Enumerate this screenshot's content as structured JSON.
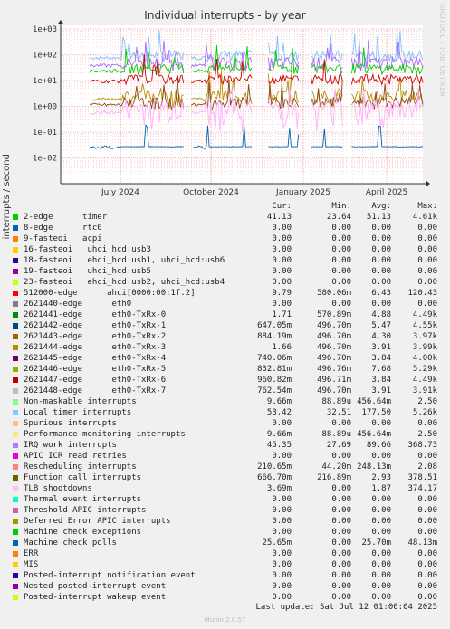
{
  "graph": {
    "title": "Individual interrupts - by year",
    "ylabel": "interrupts / second",
    "watermark": "RRDTOOL / TOBI OETIKER",
    "footer": "Munin 2.0.57",
    "last_update": "Last update: Sat Jul 12 01:00:04 2025"
  },
  "columns": {
    "cur": "Cur:",
    "min": "Min:",
    "avg": "Avg:",
    "max": "Max:"
  },
  "chart_data": {
    "type": "line",
    "title": "Individual interrupts - by year",
    "ylabel": "interrupts / second",
    "yscale": "log",
    "ylim": [
      0.001,
      1000
    ],
    "y_ticks": [
      {
        "v": 0.01,
        "label": "1e-02"
      },
      {
        "v": 0.1,
        "label": "1e-01"
      },
      {
        "v": 1,
        "label": "1e+00"
      },
      {
        "v": 10,
        "label": "1e+01"
      },
      {
        "v": 100,
        "label": "1e+02"
      },
      {
        "v": 1000,
        "label": "1e+03"
      }
    ],
    "x_ticks": [
      {
        "t": 0.165,
        "label": "July 2024"
      },
      {
        "t": 0.415,
        "label": "October 2024"
      },
      {
        "t": 0.67,
        "label": "January 2025"
      },
      {
        "t": 0.9,
        "label": "April 2025"
      }
    ],
    "grid": true,
    "approx_series": [
      {
        "name": "Local timer interrupts",
        "color": "#7ec2ff",
        "base": 80,
        "wide": 0.6
      },
      {
        "name": "Function call interrupts",
        "color": "#b78e00",
        "base": 2,
        "wide": 0.9
      },
      {
        "name": "IRQ work interrupts",
        "color": "#a06cff",
        "base": 40,
        "wide": 0.7
      },
      {
        "name": "2-edge",
        "color": "#00cc00",
        "base": 25,
        "wide": 0.5
      },
      {
        "name": "Rescheduling interrupts",
        "color": "#cc0000",
        "base": 10,
        "wide": 0.5
      },
      {
        "name": "2621441-edge",
        "color": "#8b4513",
        "base": 1.2,
        "wide": 0.6
      },
      {
        "name": "TLB shootdowns",
        "color": "#ffb0ff",
        "base": 0.6,
        "wide": 1.4
      },
      {
        "name": "Machine check polls",
        "color": "#0066b3",
        "base": 0.027,
        "wide": 0.02
      }
    ]
  },
  "legend": [
    {
      "label": "2-edge      timer",
      "color": "#00cc00",
      "cur": "41.13",
      "min": "23.64",
      "avg": "51.13",
      "max": "4.61k"
    },
    {
      "label": "8-edge      rtc0",
      "color": "#0066b3",
      "cur": "0.00",
      "min": "0.00",
      "avg": "0.00",
      "max": "0.00"
    },
    {
      "label": "9-fasteoi   acpi",
      "color": "#ff8000",
      "cur": "0.00",
      "min": "0.00",
      "avg": "0.00",
      "max": "0.00"
    },
    {
      "label": "16-fasteoi   uhci_hcd:usb3",
      "color": "#ffcc00",
      "cur": "0.00",
      "min": "0.00",
      "avg": "0.00",
      "max": "0.00"
    },
    {
      "label": "18-fasteoi   ehci_hcd:usb1, uhci_hcd:usb6",
      "color": "#330099",
      "cur": "0.00",
      "min": "0.00",
      "avg": "0.00",
      "max": "0.00"
    },
    {
      "label": "19-fasteoi   uhci_hcd:usb5",
      "color": "#990099",
      "cur": "0.00",
      "min": "0.00",
      "avg": "0.00",
      "max": "0.00"
    },
    {
      "label": "23-fasteoi   ehci_hcd:usb2, uhci_hcd:usb4",
      "color": "#ccff00",
      "cur": "0.00",
      "min": "0.00",
      "avg": "0.00",
      "max": "0.00"
    },
    {
      "label": "512000-edge      ahci[0000:00:1f.2]",
      "color": "#ff0000",
      "cur": "9.79",
      "min": "580.06m",
      "avg": "6.43",
      "max": "120.43"
    },
    {
      "label": "2621440-edge      eth0",
      "color": "#808080",
      "cur": "0.00",
      "min": "0.00",
      "avg": "0.00",
      "max": "0.00"
    },
    {
      "label": "2621441-edge      eth0-TxRx-0",
      "color": "#008f00",
      "cur": "1.71",
      "min": "570.89m",
      "avg": "4.88",
      "max": "4.49k"
    },
    {
      "label": "2621442-edge      eth0-TxRx-1",
      "color": "#00487d",
      "cur": "647.05m",
      "min": "496.70m",
      "avg": "5.47",
      "max": "4.55k"
    },
    {
      "label": "2621443-edge      eth0-TxRx-2",
      "color": "#b35a00",
      "cur": "884.19m",
      "min": "496.70m",
      "avg": "4.30",
      "max": "3.97k"
    },
    {
      "label": "2621444-edge      eth0-TxRx-3",
      "color": "#b38f00",
      "cur": "1.66",
      "min": "496.70m",
      "avg": "3.91",
      "max": "3.99k"
    },
    {
      "label": "2621445-edge      eth0-TxRx-4",
      "color": "#6b006b",
      "cur": "740.06m",
      "min": "496.70m",
      "avg": "3.84",
      "max": "4.00k"
    },
    {
      "label": "2621446-edge      eth0-TxRx-5",
      "color": "#8fb300",
      "cur": "832.81m",
      "min": "496.76m",
      "avg": "7.68",
      "max": "5.29k"
    },
    {
      "label": "2621447-edge      eth0-TxRx-6",
      "color": "#b30000",
      "cur": "960.82m",
      "min": "496.71m",
      "avg": "3.84",
      "max": "4.49k"
    },
    {
      "label": "2621448-edge      eth0-TxRx-7",
      "color": "#bebebe",
      "cur": "762.54m",
      "min": "496.70m",
      "avg": "3.91",
      "max": "3.91k"
    },
    {
      "label": "Non-maskable interrupts",
      "color": "#80ff80",
      "cur": "9.66m",
      "min": "88.89u",
      "avg": "456.64m",
      "max": "2.50"
    },
    {
      "label": "Local timer interrupts",
      "color": "#80c9ff",
      "cur": "53.42",
      "min": "32.51",
      "avg": "177.50",
      "max": "5.26k"
    },
    {
      "label": "Spurious interrupts",
      "color": "#ffc080",
      "cur": "0.00",
      "min": "0.00",
      "avg": "0.00",
      "max": "0.00"
    },
    {
      "label": "Performance monitoring interrupts",
      "color": "#ffe680",
      "cur": "9.66m",
      "min": "88.89u",
      "avg": "456.64m",
      "max": "2.50"
    },
    {
      "label": "IRQ work interrupts",
      "color": "#aa80ff",
      "cur": "45.35",
      "min": "27.69",
      "avg": "89.66",
      "max": "368.73"
    },
    {
      "label": "APIC ICR read retries",
      "color": "#ee00cc",
      "cur": "0.00",
      "min": "0.00",
      "avg": "0.00",
      "max": "0.00"
    },
    {
      "label": "Rescheduling interrupts",
      "color": "#ff8080",
      "cur": "210.65m",
      "min": "44.20m",
      "avg": "248.13m",
      "max": "2.08"
    },
    {
      "label": "Function call interrupts",
      "color": "#666600",
      "cur": "666.70m",
      "min": "216.89m",
      "avg": "2.93",
      "max": "378.51"
    },
    {
      "label": "TLB shootdowns",
      "color": "#ffbfff",
      "cur": "3.69m",
      "min": "0.00",
      "avg": "1.87",
      "max": "374.17"
    },
    {
      "label": "Thermal event interrupts",
      "color": "#00ffcc",
      "cur": "0.00",
      "min": "0.00",
      "avg": "0.00",
      "max": "0.00"
    },
    {
      "label": "Threshold APIC interrupts",
      "color": "#cc6699",
      "cur": "0.00",
      "min": "0.00",
      "avg": "0.00",
      "max": "0.00"
    },
    {
      "label": "Deferred Error APIC interrupts",
      "color": "#999900",
      "cur": "0.00",
      "min": "0.00",
      "avg": "0.00",
      "max": "0.00"
    },
    {
      "label": "Machine check exceptions",
      "color": "#00cc00",
      "cur": "0.00",
      "min": "0.00",
      "avg": "0.00",
      "max": "0.00"
    },
    {
      "label": "Machine check polls",
      "color": "#0066b3",
      "cur": "25.65m",
      "min": "0.00",
      "avg": "25.70m",
      "max": "48.13m"
    },
    {
      "label": "ERR",
      "color": "#ff8000",
      "cur": "0.00",
      "min": "0.00",
      "avg": "0.00",
      "max": "0.00"
    },
    {
      "label": "MIS",
      "color": "#ffcc00",
      "cur": "0.00",
      "min": "0.00",
      "avg": "0.00",
      "max": "0.00"
    },
    {
      "label": "Posted-interrupt notification event",
      "color": "#330099",
      "cur": "0.00",
      "min": "0.00",
      "avg": "0.00",
      "max": "0.00"
    },
    {
      "label": "Nested posted-interrupt event",
      "color": "#990099",
      "cur": "0.00",
      "min": "0.00",
      "avg": "0.00",
      "max": "0.00"
    },
    {
      "label": "Posted-interrupt wakeup event",
      "color": "#ccff00",
      "cur": "0.00",
      "min": "0.00",
      "avg": "0.00",
      "max": "0.00"
    }
  ]
}
